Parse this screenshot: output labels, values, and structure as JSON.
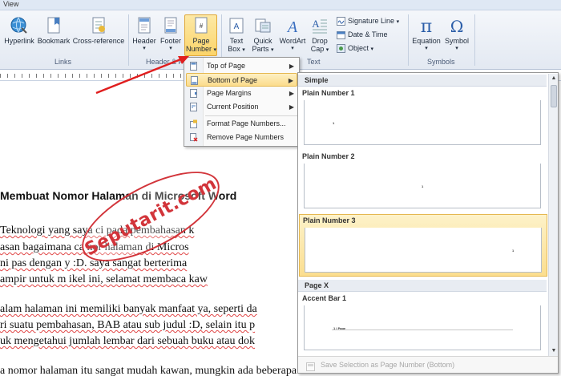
{
  "tabstrip": {
    "label": "View"
  },
  "ribbon": {
    "groups": {
      "links": "Links",
      "header_footer": "Header & F",
      "text": "Text",
      "symbols": "Symbols"
    },
    "buttons": {
      "hyperlink": "Hyperlink",
      "bookmark": "Bookmark",
      "cross_reference": "Cross-reference",
      "header": "Header",
      "footer": "Footer",
      "page_number_1": "Page",
      "page_number_2": "Number",
      "text_box_1": "Text",
      "text_box_2": "Box",
      "quick_parts_1": "Quick",
      "quick_parts_2": "Parts",
      "wordart": "WordArt",
      "drop_cap_1": "Drop",
      "drop_cap_2": "Cap",
      "equation": "Equation",
      "symbol": "Symbol"
    },
    "small": {
      "signature_line": "Signature Line",
      "date_time": "Date & Time",
      "object": "Object"
    },
    "dropdown_glyph": "▾"
  },
  "menu": {
    "items": [
      {
        "label": "Top of Page",
        "has_submenu": true
      },
      {
        "label": "Bottom of Page",
        "has_submenu": true
      },
      {
        "label": "Page Margins",
        "has_submenu": true
      },
      {
        "label": "Current Position",
        "has_submenu": true
      },
      {
        "label": "Format Page Numbers..."
      },
      {
        "label": "Remove Page Numbers"
      }
    ],
    "submenu_glyph": "▶"
  },
  "gallery": {
    "sections": {
      "simple": "Simple",
      "page_x": "Page X"
    },
    "items": [
      {
        "title": "Plain Number 1",
        "number": "1"
      },
      {
        "title": "Plain Number 2",
        "number": "1"
      },
      {
        "title": "Plain Number 3",
        "number": "1"
      },
      {
        "title": "Accent Bar 1",
        "number": "1 | Page"
      }
    ],
    "footer": "Save Selection as Page Number (Bottom)",
    "scroll_up": "▲",
    "scroll_down": "▼"
  },
  "document": {
    "heading": "Membuat Nomor Halaman di Microsoft Word",
    "lines": [
      "Teknologi yang saya ci                      pada pembahasan k",
      "asan bagaimana ca                    nor halaman di Micros",
      "ni pas dengan y                 :D. saya sangat berterima",
      "ampir untuk m              ikel ini, selamat membaca kaw",
      "alam halaman ini memiliki banyak manfaat ya, seperti da",
      "ri suatu pembahasan, BAB atau sub judul :D, selain itu p",
      "uk mengetahui jumlah lembar dari sebuah buku atau dok",
      "a nomor halaman itu sangat mudah kawan, mungkin ada beberapa teman"
    ]
  },
  "watermark": {
    "text": "Seputarit.com"
  },
  "colors": {
    "accent": "#fbd46a",
    "watermark": "#d2343a",
    "squiggle": "#e04545"
  }
}
